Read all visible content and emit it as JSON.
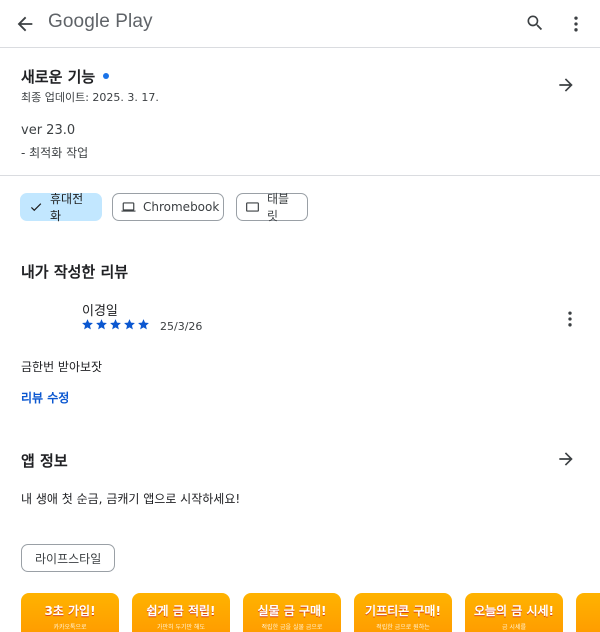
{
  "appbar": {
    "brand": "Google Play"
  },
  "whats_new": {
    "title": "새로운 기능",
    "updated": "최종 업데이트: 2025. 3. 17.",
    "version": "ver 23.0",
    "note": "- 최적화 작업"
  },
  "device_chips": [
    {
      "label": "휴대전화",
      "icon": "check-icon",
      "selected": true
    },
    {
      "label": "Chromebook",
      "icon": "laptop-icon",
      "selected": false
    },
    {
      "label": "태블릿",
      "icon": "tablet-icon",
      "selected": false
    }
  ],
  "my_review": {
    "title": "내가 작성한 리뷰",
    "reviewer": "이경일",
    "rating": 5,
    "date": "25/3/26",
    "text": "금한번 받아보잣",
    "edit_label": "리뷰 수정"
  },
  "about": {
    "title": "앱 정보",
    "description": "내 생애 첫 순금, 금캐기 앱으로 시작하세요!",
    "category": "라이프스타일"
  },
  "screenshots": [
    {
      "title": "3초 가입!",
      "subtitle": "카카오톡으로"
    },
    {
      "title": "쉽게 금 적립!",
      "subtitle": "가만히 두기만 해도"
    },
    {
      "title": "실물 금 구매!",
      "subtitle": "적립한 금을 실물 금으로"
    },
    {
      "title": "기프티콘 구매!",
      "subtitle": "적립한 금으로 원하는"
    },
    {
      "title": "오늘의 금 시세!",
      "subtitle": "금 시세를"
    }
  ],
  "colors": {
    "accent": "#0b57d0",
    "selected_chip": "#c2e7ff",
    "star": "#0b57d0",
    "screenshot_bg": "#ffa000"
  }
}
